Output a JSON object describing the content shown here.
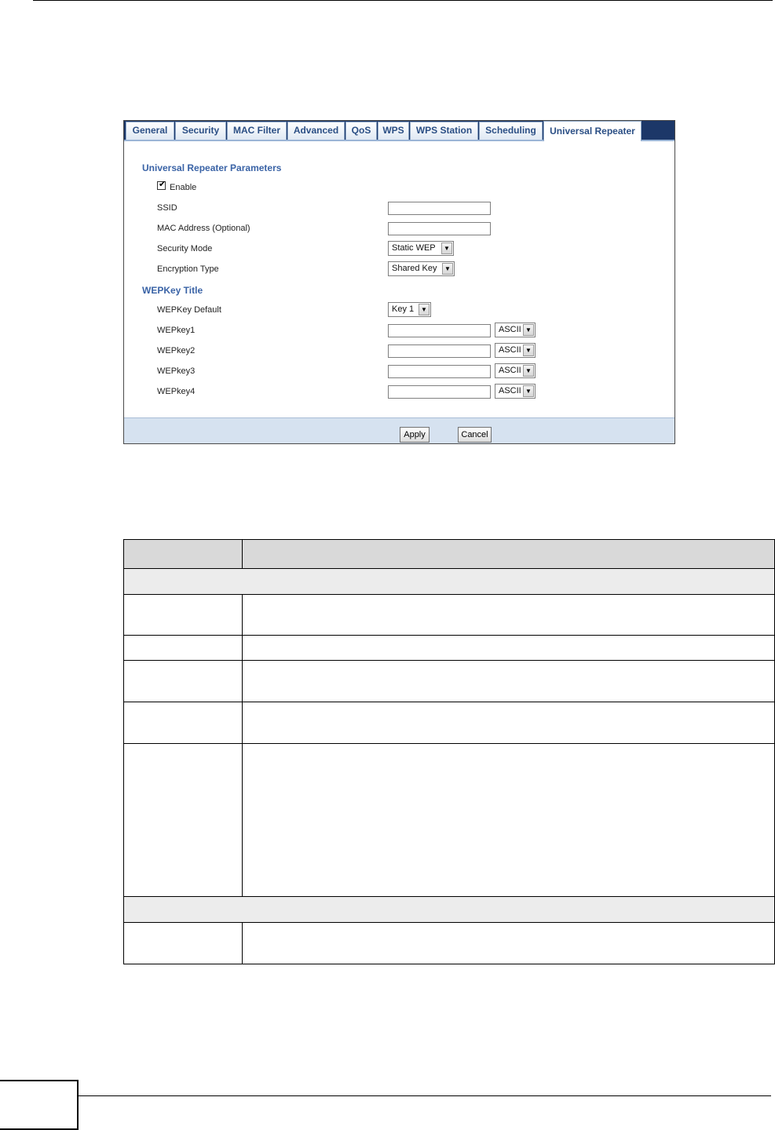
{
  "tabs": [
    "General",
    "Security",
    "MAC Filter",
    "Advanced",
    "QoS",
    "WPS",
    "WPS Station",
    "Scheduling",
    "Universal Repeater"
  ],
  "active_tab": "Universal Repeater",
  "form": {
    "section1_title": "Universal Repeater Parameters",
    "enable_label": "Enable",
    "enable_checked": true,
    "ssid_label": "SSID",
    "ssid_value": "",
    "mac_label": "MAC Address (Optional)",
    "mac_value": "",
    "security_mode_label": "Security Mode",
    "security_mode_value": "Static WEP",
    "encryption_type_label": "Encryption Type",
    "encryption_type_value": "Shared Key",
    "section2_title": "WEPKey Title",
    "wepkey_default_label": "WEPKey Default",
    "wepkey_default_value": "Key 1",
    "wepkeys": [
      {
        "label": "WEPkey1",
        "value": "",
        "format": "ASCII"
      },
      {
        "label": "WEPkey2",
        "value": "",
        "format": "ASCII"
      },
      {
        "label": "WEPkey3",
        "value": "",
        "format": "ASCII"
      },
      {
        "label": "WEPkey4",
        "value": "",
        "format": "ASCII"
      }
    ]
  },
  "buttons": {
    "apply": "Apply",
    "cancel": "Cancel"
  }
}
